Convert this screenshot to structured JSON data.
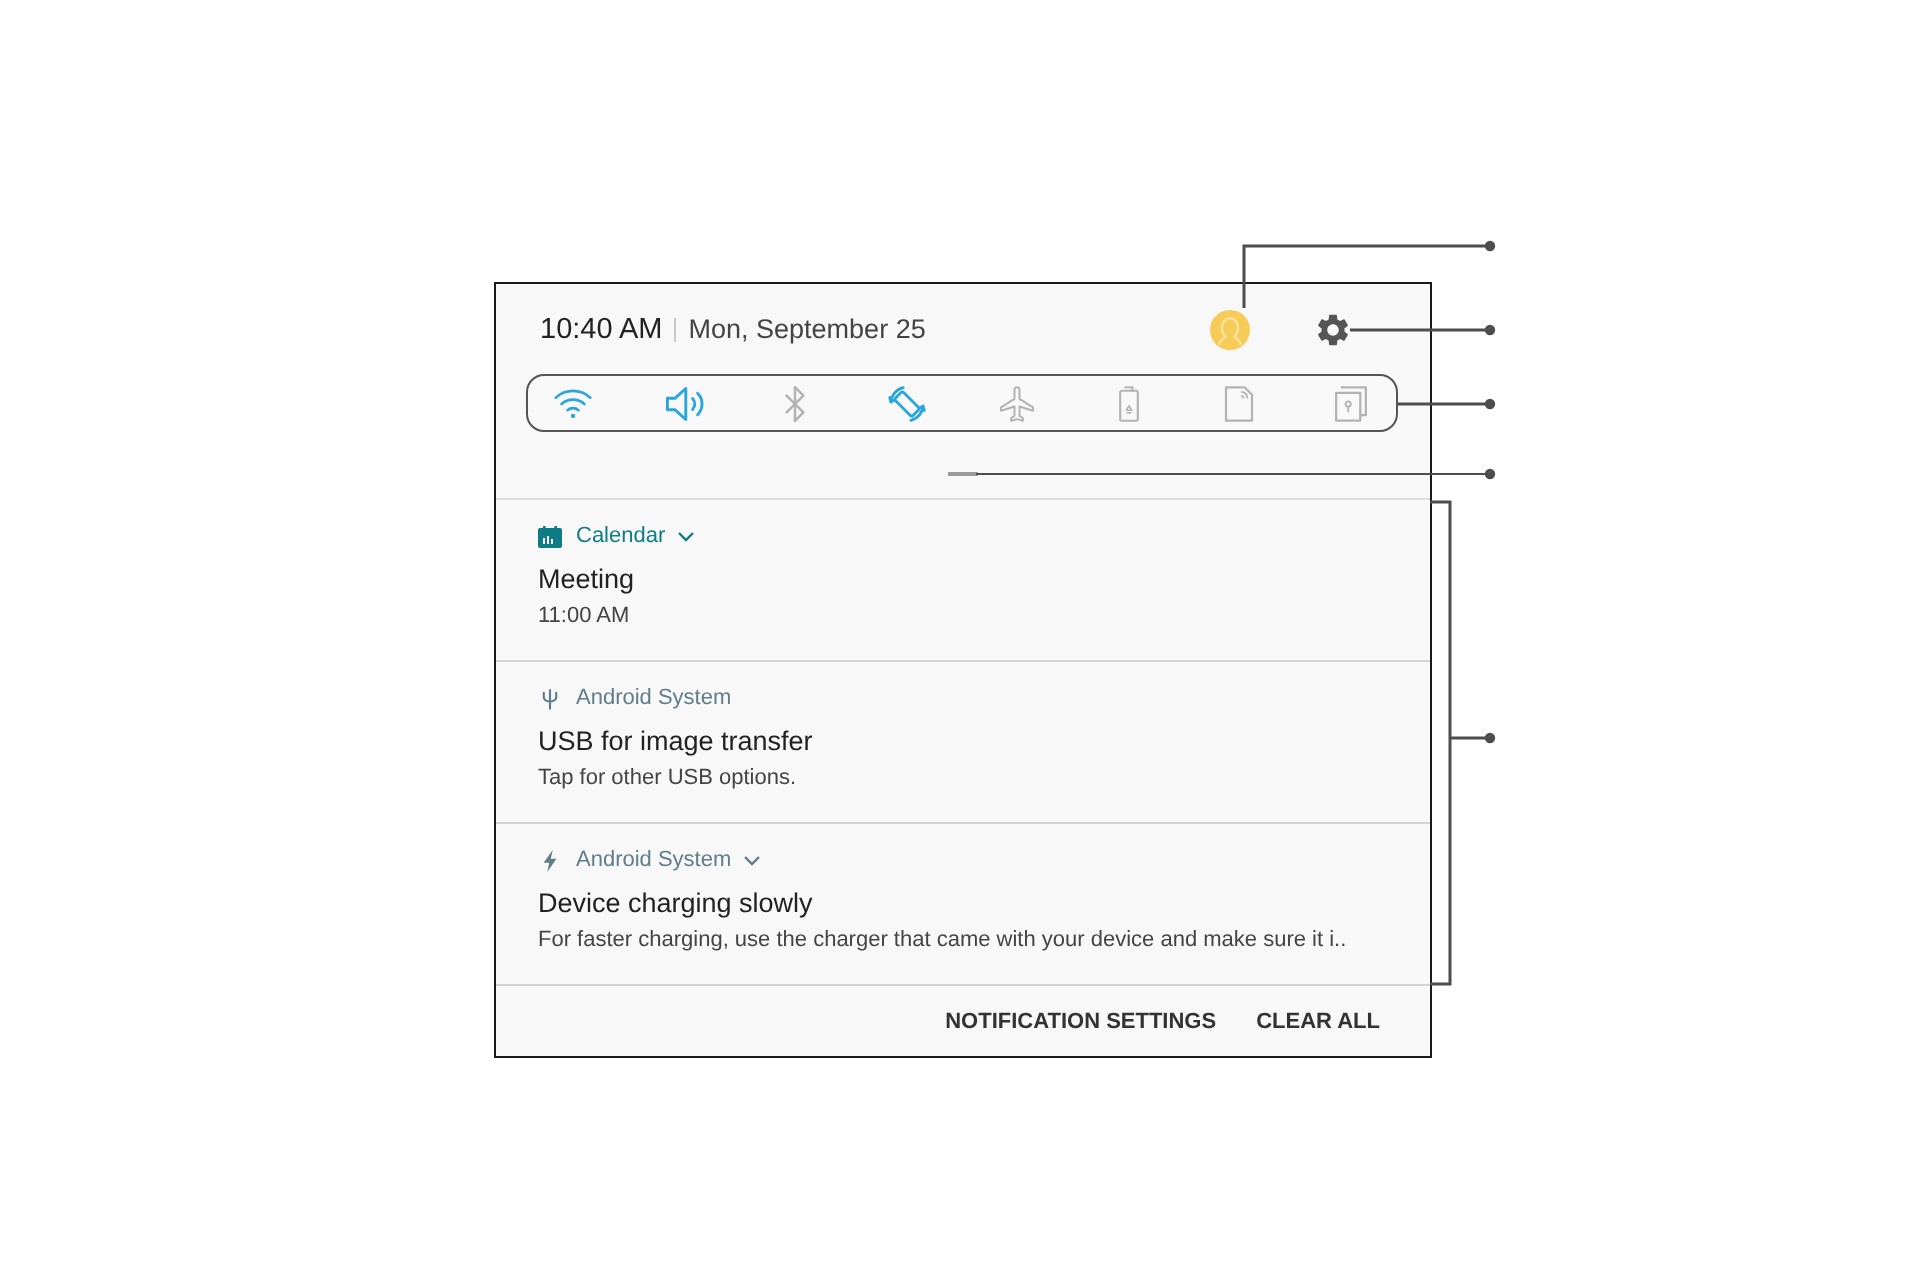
{
  "status_bar": {
    "time": "10:40 AM",
    "date": "Mon, September 25"
  },
  "quick_settings": [
    {
      "kind": "wifi",
      "on": true
    },
    {
      "kind": "sound",
      "on": true
    },
    {
      "kind": "bluetooth",
      "on": false
    },
    {
      "kind": "rotate",
      "on": true
    },
    {
      "kind": "airplane",
      "on": false
    },
    {
      "kind": "battery",
      "on": false
    },
    {
      "kind": "cast",
      "on": false
    },
    {
      "kind": "secure",
      "on": false
    }
  ],
  "notifications": [
    {
      "kind": "calendar",
      "app": "Calendar",
      "color": "#0e7c86",
      "expandable": true,
      "title": "Meeting",
      "text": "11:00 AM"
    },
    {
      "kind": "usb",
      "app": "Android System",
      "color": "#5f7d8a",
      "expandable": false,
      "title": "USB for image transfer",
      "text": "Tap for other USB options."
    },
    {
      "kind": "charging",
      "app": "Android System",
      "color": "#5f7d8a",
      "expandable": true,
      "title": "Device charging slowly",
      "text": "For faster charging, use the charger that came with your device and make sure it i.."
    }
  ],
  "footer_buttons": [
    "NOTIFICATION SETTINGS",
    "CLEAR ALL"
  ]
}
